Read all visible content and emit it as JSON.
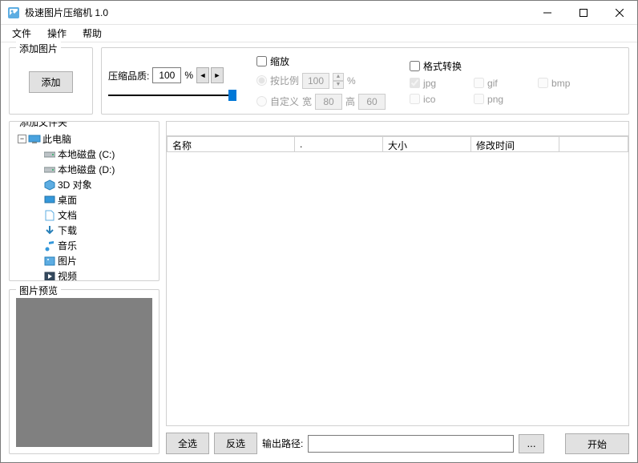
{
  "window": {
    "title": "极速图片压缩机 1.0"
  },
  "menu": {
    "file": "文件",
    "operation": "操作",
    "help": "帮助"
  },
  "add_image": {
    "legend": "添加图片",
    "button": "添加"
  },
  "quality": {
    "label": "压缩品质:",
    "value": "100",
    "unit": "%"
  },
  "scale": {
    "enable": "缩放",
    "by_ratio": "按比例",
    "ratio_value": "100",
    "ratio_unit": "%",
    "custom": "自定义",
    "width_label": "宽",
    "width_value": "80",
    "height_label": "高",
    "height_value": "60"
  },
  "format": {
    "enable": "格式转换",
    "jpg": "jpg",
    "gif": "gif",
    "bmp": "bmp",
    "ico": "ico",
    "png": "png"
  },
  "folder": {
    "legend": "添加文件夹",
    "this_pc": "此电脑",
    "drive_c": "本地磁盘 (C:)",
    "drive_d": "本地磁盘 (D:)",
    "objects_3d": "3D 对象",
    "desktop": "桌面",
    "documents": "文档",
    "downloads": "下载",
    "music": "音乐",
    "pictures": "图片",
    "videos": "视频"
  },
  "preview": {
    "legend": "图片预览"
  },
  "table": {
    "name": "名称",
    "dot": ".",
    "size": "大小",
    "modified": "修改时间"
  },
  "controls": {
    "select_all": "全选",
    "invert": "反选",
    "output_path": "输出路径:",
    "browse": "...",
    "start": "开始"
  }
}
